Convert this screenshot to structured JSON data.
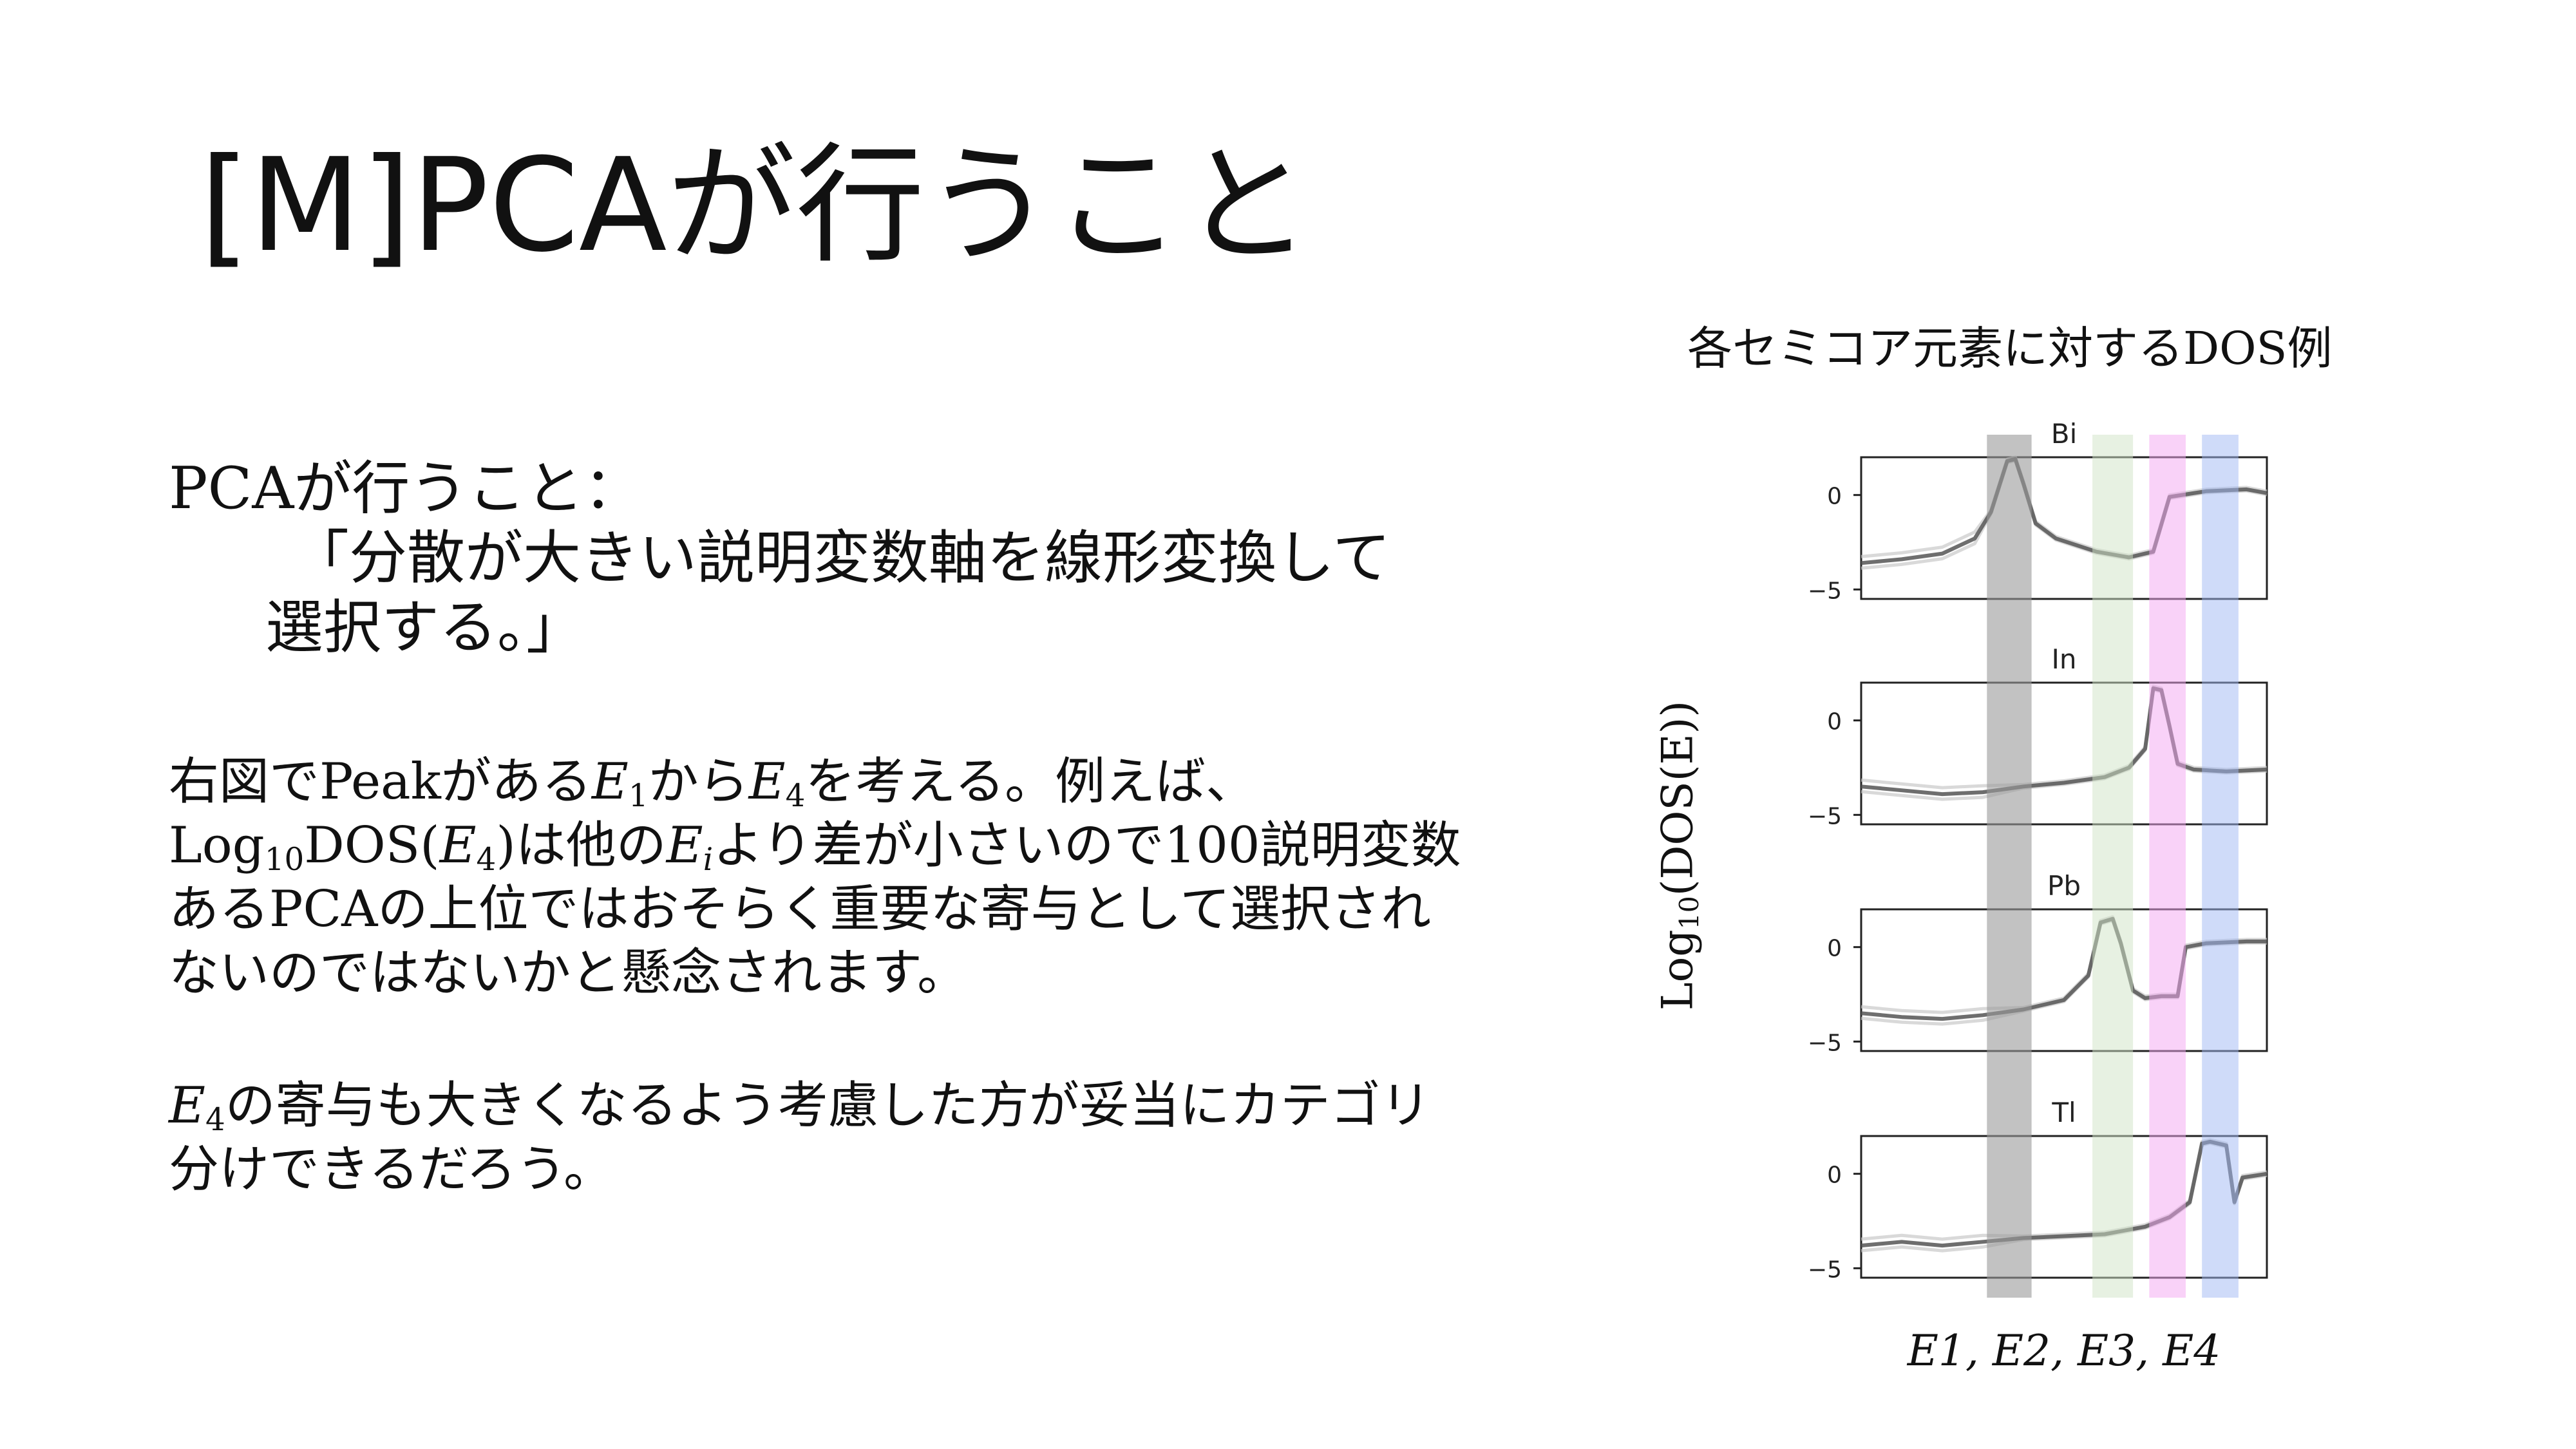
{
  "title": "[M]PCAが行うこと",
  "pca_box": {
    "heading": "PCAが行うこと：",
    "line2": "「分散が大きい説明変数軸を線形変換して",
    "line3": "選択する。」"
  },
  "para2": {
    "l1_a": "右図でPeakがある",
    "l1_b": "から",
    "l1_c": "を考える。例えば、",
    "l2_a": "Log",
    "l2_sub": "10",
    "l2_b": "DOS(",
    "l2_c": ")は他の",
    "l2_d": "より差が小さいので100説明変数",
    "l3": "あるPCAの上位ではおそらく重要な寄与として選択され",
    "l4": "ないのではないかと懸念されます。"
  },
  "para3": {
    "l1_b": "の寄与も大きくなるよう考慮した方が妥当にカテゴリ",
    "l2": "分けできるだろう。"
  },
  "math": {
    "E": "E",
    "sub1": "1",
    "sub2": "2",
    "sub3": "3",
    "sub4": "4",
    "subi": "i"
  },
  "figure": {
    "caption": "各セミコア元素に対するDOS例",
    "ylabel_prefix": "Log",
    "ylabel_sub": "10",
    "ylabel_suffix": "(DOS(E))",
    "xlabel": "E1,  E2, E3, E4",
    "y_ticks": [
      "0",
      "−5"
    ],
    "band_colors": [
      "#9a9a9a",
      "#cfe3c6",
      "#f3a6f2",
      "#9fb8f4"
    ]
  },
  "chart_data": {
    "type": "line",
    "ylim": [
      -5.5,
      2
    ],
    "xlim": [
      0,
      1
    ],
    "panels": [
      {
        "name": "Bi",
        "x": [
          0.0,
          0.1,
          0.2,
          0.28,
          0.32,
          0.36,
          0.38,
          0.4,
          0.43,
          0.48,
          0.58,
          0.66,
          0.7,
          0.72,
          0.76,
          0.85,
          0.95,
          1.0
        ],
        "y": [
          -3.6,
          -3.4,
          -3.1,
          -2.3,
          -0.9,
          1.8,
          1.9,
          0.6,
          -1.5,
          -2.3,
          -3.0,
          -3.3,
          -3.1,
          -3.0,
          -0.1,
          0.2,
          0.3,
          0.1
        ]
      },
      {
        "name": "In",
        "x": [
          0.0,
          0.1,
          0.2,
          0.3,
          0.4,
          0.5,
          0.6,
          0.66,
          0.7,
          0.72,
          0.74,
          0.76,
          0.78,
          0.82,
          0.9,
          1.0
        ],
        "y": [
          -3.5,
          -3.7,
          -3.9,
          -3.8,
          -3.5,
          -3.3,
          -3.0,
          -2.5,
          -1.5,
          1.7,
          1.6,
          -0.3,
          -2.3,
          -2.6,
          -2.7,
          -2.6
        ]
      },
      {
        "name": "Pb",
        "x": [
          0.0,
          0.1,
          0.2,
          0.3,
          0.4,
          0.5,
          0.56,
          0.59,
          0.62,
          0.64,
          0.67,
          0.7,
          0.74,
          0.78,
          0.8,
          0.85,
          0.95,
          1.0
        ],
        "y": [
          -3.5,
          -3.7,
          -3.8,
          -3.6,
          -3.3,
          -2.8,
          -1.5,
          1.3,
          1.5,
          0.2,
          -2.3,
          -2.7,
          -2.6,
          -2.6,
          0.0,
          0.2,
          0.3,
          0.3
        ]
      },
      {
        "name": "Tl",
        "x": [
          0.0,
          0.1,
          0.2,
          0.3,
          0.4,
          0.5,
          0.6,
          0.7,
          0.76,
          0.81,
          0.84,
          0.86,
          0.9,
          0.92,
          0.94,
          0.97,
          1.0
        ],
        "y": [
          -3.8,
          -3.6,
          -3.8,
          -3.6,
          -3.4,
          -3.3,
          -3.2,
          -2.8,
          -2.3,
          -1.5,
          1.6,
          1.7,
          1.5,
          -1.5,
          -0.2,
          -0.1,
          0.0
        ]
      }
    ]
  }
}
